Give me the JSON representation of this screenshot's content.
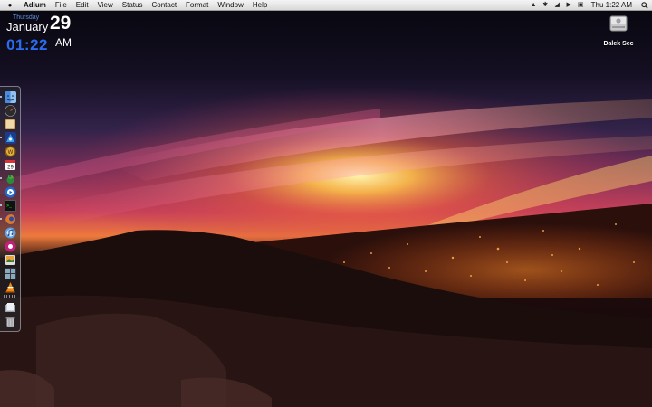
{
  "menubar": {
    "apple_icon": "apple-logo-icon",
    "app_name": "Adium",
    "menus": [
      "File",
      "Edit",
      "View",
      "Status",
      "Contact",
      "Format",
      "Window",
      "Help"
    ],
    "status_icons": [
      "adium-duck-icon",
      "bluetooth-icon",
      "wifi-icon",
      "volume-icon",
      "display-icon"
    ],
    "clock": "Thu 1:22 AM",
    "spotlight_icon": "spotlight-search-icon"
  },
  "clock_widget": {
    "weekday": "Thursday",
    "month": "January",
    "date": "29",
    "time": "01:22",
    "ampm": "AM"
  },
  "desktop": {
    "drive_label": "Dalek Sec",
    "drive_icon": "hard-drive-icon"
  },
  "dock": {
    "items": [
      {
        "name": "finder-icon",
        "running": true
      },
      {
        "name": "dashboard-icon",
        "running": false
      },
      {
        "name": "address-book-icon",
        "running": false
      },
      {
        "name": "adium-icon",
        "running": true
      },
      {
        "name": "world-of-warcraft-icon",
        "running": false
      },
      {
        "name": "ical-icon",
        "running": false
      },
      {
        "name": "adium-duck-icon",
        "running": true
      },
      {
        "name": "quicktime-icon",
        "running": false
      },
      {
        "name": "terminal-icon",
        "running": true
      },
      {
        "name": "firefox-icon",
        "running": true
      },
      {
        "name": "itunes-icon",
        "running": false
      },
      {
        "name": "photo-booth-icon",
        "running": false
      },
      {
        "name": "iphoto-icon",
        "running": false
      },
      {
        "name": "spaces-icon",
        "running": false
      },
      {
        "name": "vlc-icon",
        "running": false
      },
      {
        "name": "downloads-stack-icon",
        "running": false
      },
      {
        "name": "trash-icon",
        "running": false
      }
    ],
    "colors": {
      "finder": "#4a8ce0",
      "firefox": "#e5761c",
      "adium": "#3da0e8"
    }
  }
}
